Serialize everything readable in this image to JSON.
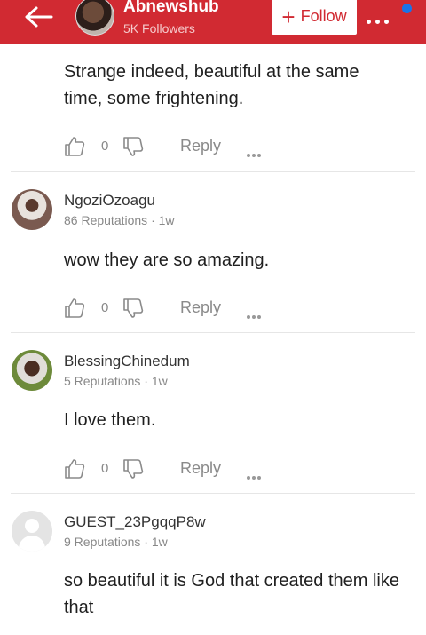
{
  "header": {
    "channel_name": "Abnewshub",
    "followers": "5K Followers",
    "follow_label": "Follow",
    "colors": {
      "bar": "#d12a32",
      "notification": "#1a73e8"
    }
  },
  "top_comment": {
    "text": "Strange  indeed, beautiful at the same time, some frightening.",
    "likes": "0",
    "reply_label": "Reply"
  },
  "comments": [
    {
      "username": "NgoziOzoagu",
      "meta": "86 Reputations · 1w",
      "text": "wow they are so amazing.",
      "likes": "0",
      "reply_label": "Reply"
    },
    {
      "username": "BlessingChinedum",
      "meta": "5 Reputations · 1w",
      "text": "I love them.",
      "likes": "0",
      "reply_label": "Reply"
    },
    {
      "username": "GUEST_23PgqqP8w",
      "meta": "9 Reputations · 1w",
      "text": "so beautiful it is God that created them like that"
    }
  ]
}
